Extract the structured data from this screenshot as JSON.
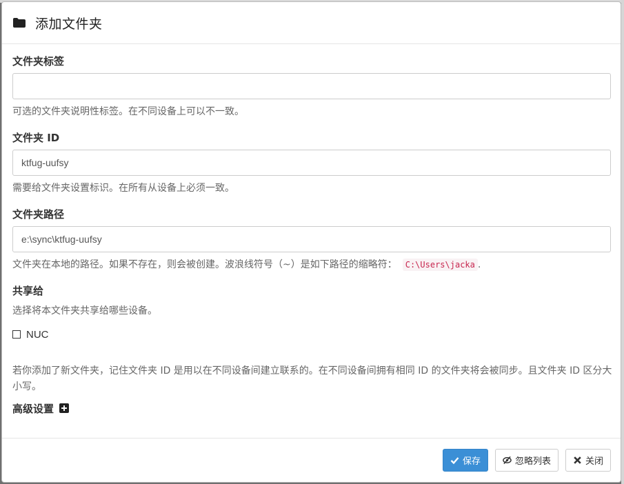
{
  "dialog": {
    "title": "添加文件夹",
    "icon": "folder-icon"
  },
  "fields": {
    "label": {
      "title": "文件夹标签",
      "value": "",
      "help": "可选的文件夹说明性标签。在不同设备上可以不一致。"
    },
    "id": {
      "title": "文件夹 ID",
      "value": "ktfug-uufsy",
      "help": "需要给文件夹设置标识。在所有从设备上必须一致。"
    },
    "path": {
      "title": "文件夹路径",
      "value": "e:\\sync\\ktfug-uufsy",
      "help": "文件夹在本地的路径。如果不存在，则会被创建。波浪线符号（~）是如下路径的缩略符：",
      "home_dir": "C:\\Users\\jacka",
      "help_suffix": "."
    }
  },
  "share": {
    "title": "共享给",
    "help": "选择将本文件夹共享给哪些设备。",
    "devices": [
      {
        "name": "NUC",
        "checked": false
      }
    ]
  },
  "note": "若你添加了新文件夹，记住文件夹 ID 是用以在不同设备间建立联系的。在不同设备间拥有相同 ID 的文件夹将会被同步。且文件夹 ID 区分大小写。",
  "advanced": {
    "label": "高级设置",
    "icon": "plus-square-icon"
  },
  "footer": {
    "save_label": "保存",
    "ignore_label": "忽略列表",
    "close_label": "关闭"
  },
  "colors": {
    "primary": "#3b8fd6",
    "code_text": "#c7254e"
  }
}
